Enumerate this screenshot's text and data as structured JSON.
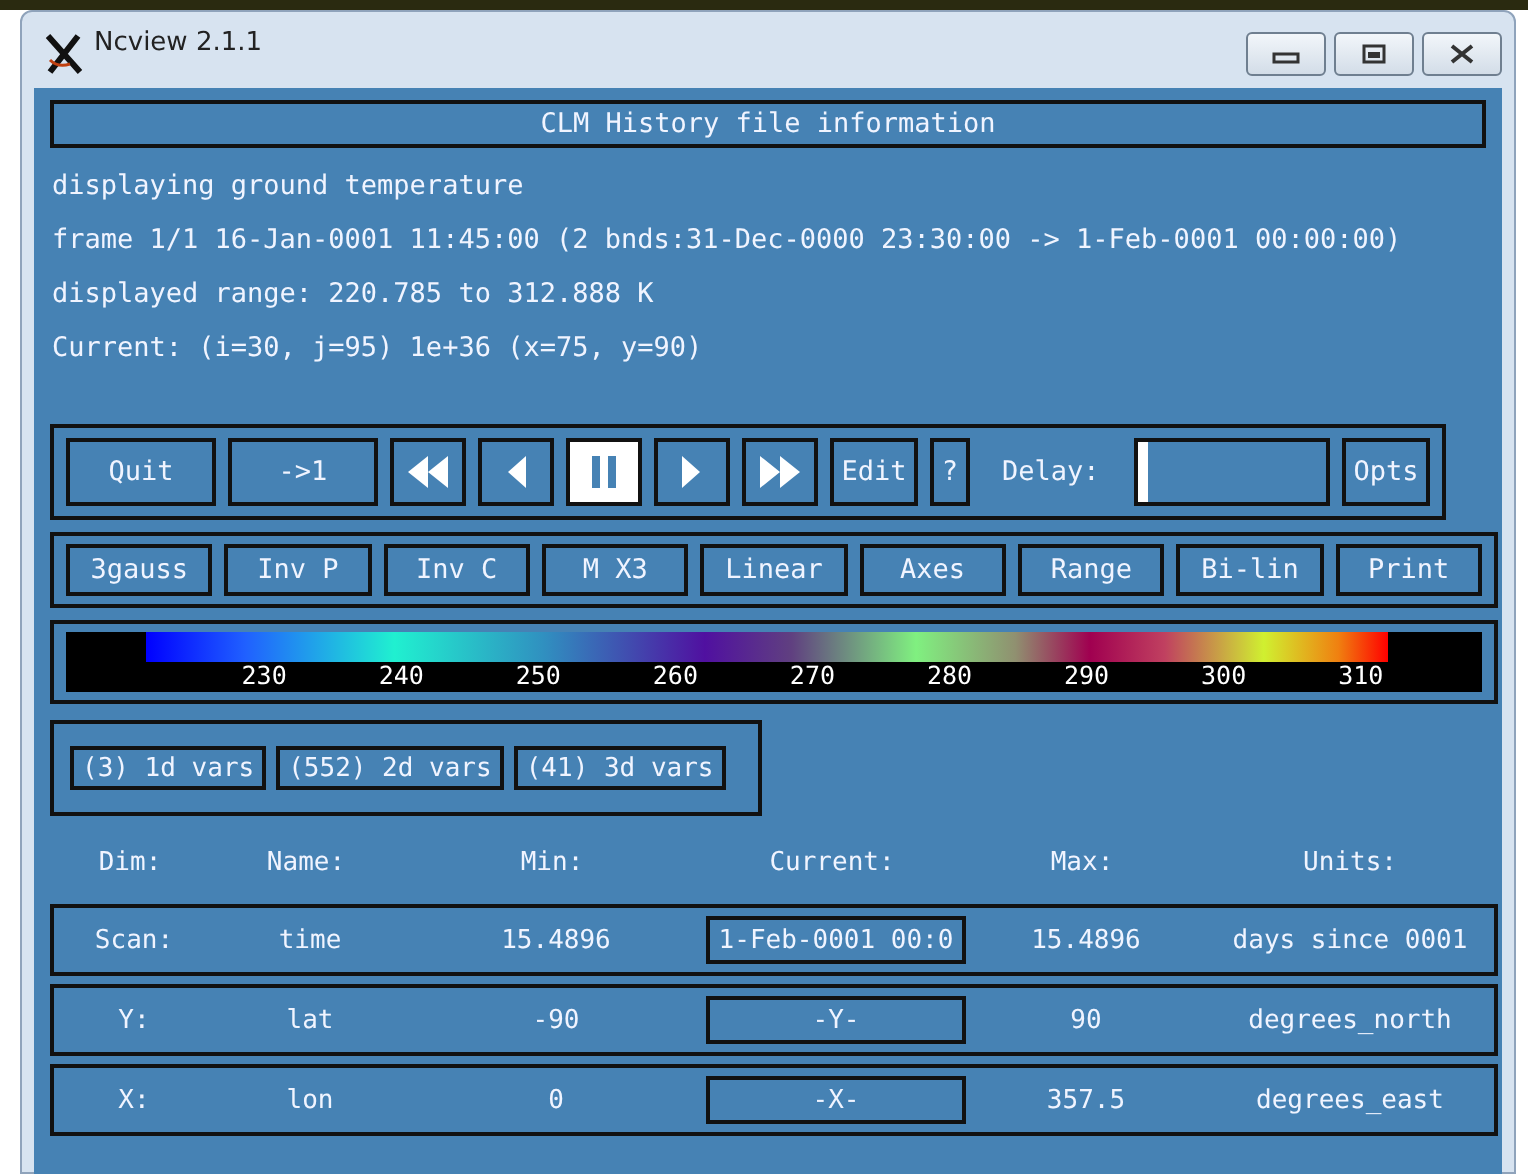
{
  "window": {
    "title": "Ncview 2.1.1"
  },
  "header": "CLM History file information",
  "info_lines": [
    "displaying ground temperature",
    "frame 1/1 16-Jan-0001 11:45:00 (2 bnds:31-Dec-0000 23:30:00 -> 1-Feb-0001 00:00:00)",
    "displayed range: 220.785 to 312.888 K",
    "Current: (i=30, j=95) 1e+36 (x=75, y=90)"
  ],
  "controls": [
    {
      "kind": "text",
      "label": "Quit",
      "selected": false
    },
    {
      "kind": "text",
      "label": "->1",
      "selected": false
    },
    {
      "kind": "rewind",
      "selected": false
    },
    {
      "kind": "back",
      "selected": false
    },
    {
      "kind": "pause",
      "selected": true
    },
    {
      "kind": "forward",
      "selected": false
    },
    {
      "kind": "fastforward",
      "selected": false
    },
    {
      "kind": "text",
      "label": "Edit",
      "selected": false
    },
    {
      "kind": "text",
      "label": "?",
      "selected": false
    }
  ],
  "delay": {
    "label": "Delay:",
    "level": 0.05
  },
  "opts_button": "Opts",
  "options": [
    "3gauss",
    "Inv P",
    "Inv C",
    "M X3",
    "Linear",
    "Axes",
    "Range",
    "Bi-lin",
    "Print"
  ],
  "colorbar": {
    "ticks": [
      "230",
      "240",
      "250",
      "260",
      "270",
      "280",
      "290",
      "300",
      "310"
    ]
  },
  "var_groups": [
    "(3) 1d vars",
    "(552) 2d vars",
    "(41) 3d vars"
  ],
  "dim_columns": [
    "Dim:",
    "Name:",
    "Min:",
    "Current:",
    "Max:",
    "Units:"
  ],
  "dims": [
    {
      "dim": "Scan:",
      "name": "time",
      "min": "15.4896",
      "current": "1-Feb-0001 00:0",
      "max": "15.4896",
      "units": "days since 0001"
    },
    {
      "dim": "Y:",
      "name": "lat",
      "min": "-90",
      "current": "-Y-",
      "max": "90",
      "units": "degrees_north"
    },
    {
      "dim": "X:",
      "name": "lon",
      "min": "0",
      "current": "-X-",
      "max": "357.5",
      "units": "degrees_east"
    }
  ]
}
